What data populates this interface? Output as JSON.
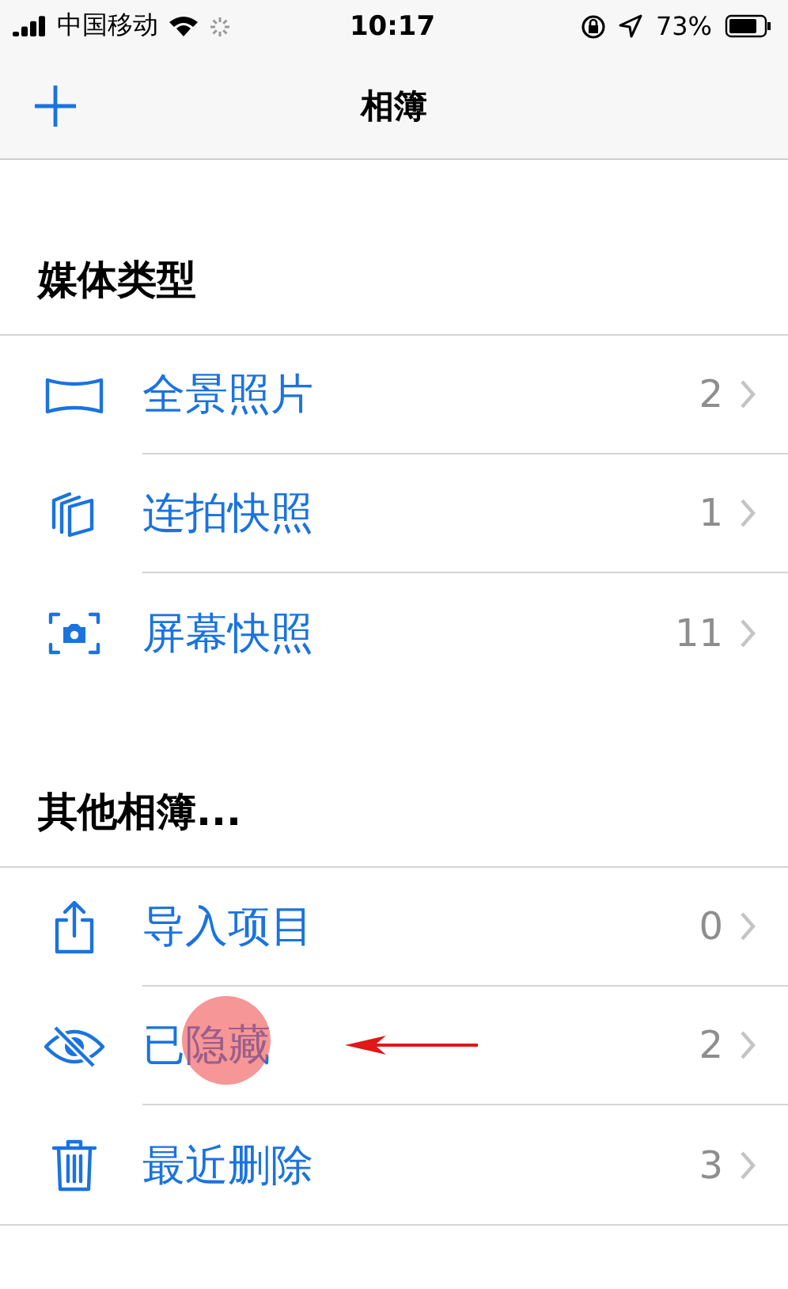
{
  "status_bar": {
    "carrier": "中国移动",
    "time": "10:17",
    "battery": "73%"
  },
  "nav": {
    "title": "相簿"
  },
  "sections": [
    {
      "title": "媒体类型",
      "items": [
        {
          "kind": "panorama",
          "label": "全景照片",
          "count": "2",
          "highlighted": false
        },
        {
          "kind": "burst",
          "label": "连拍快照",
          "count": "1",
          "highlighted": false
        },
        {
          "kind": "screenshot",
          "label": "屏幕快照",
          "count": "11",
          "highlighted": false
        }
      ]
    },
    {
      "title": "其他相簿...",
      "items": [
        {
          "kind": "import",
          "label": "导入项目",
          "count": "0",
          "highlighted": false
        },
        {
          "kind": "hidden",
          "label": "已隐藏",
          "count": "2",
          "highlighted": true
        },
        {
          "kind": "trash",
          "label": "最近删除",
          "count": "3",
          "highlighted": false
        }
      ]
    }
  ]
}
